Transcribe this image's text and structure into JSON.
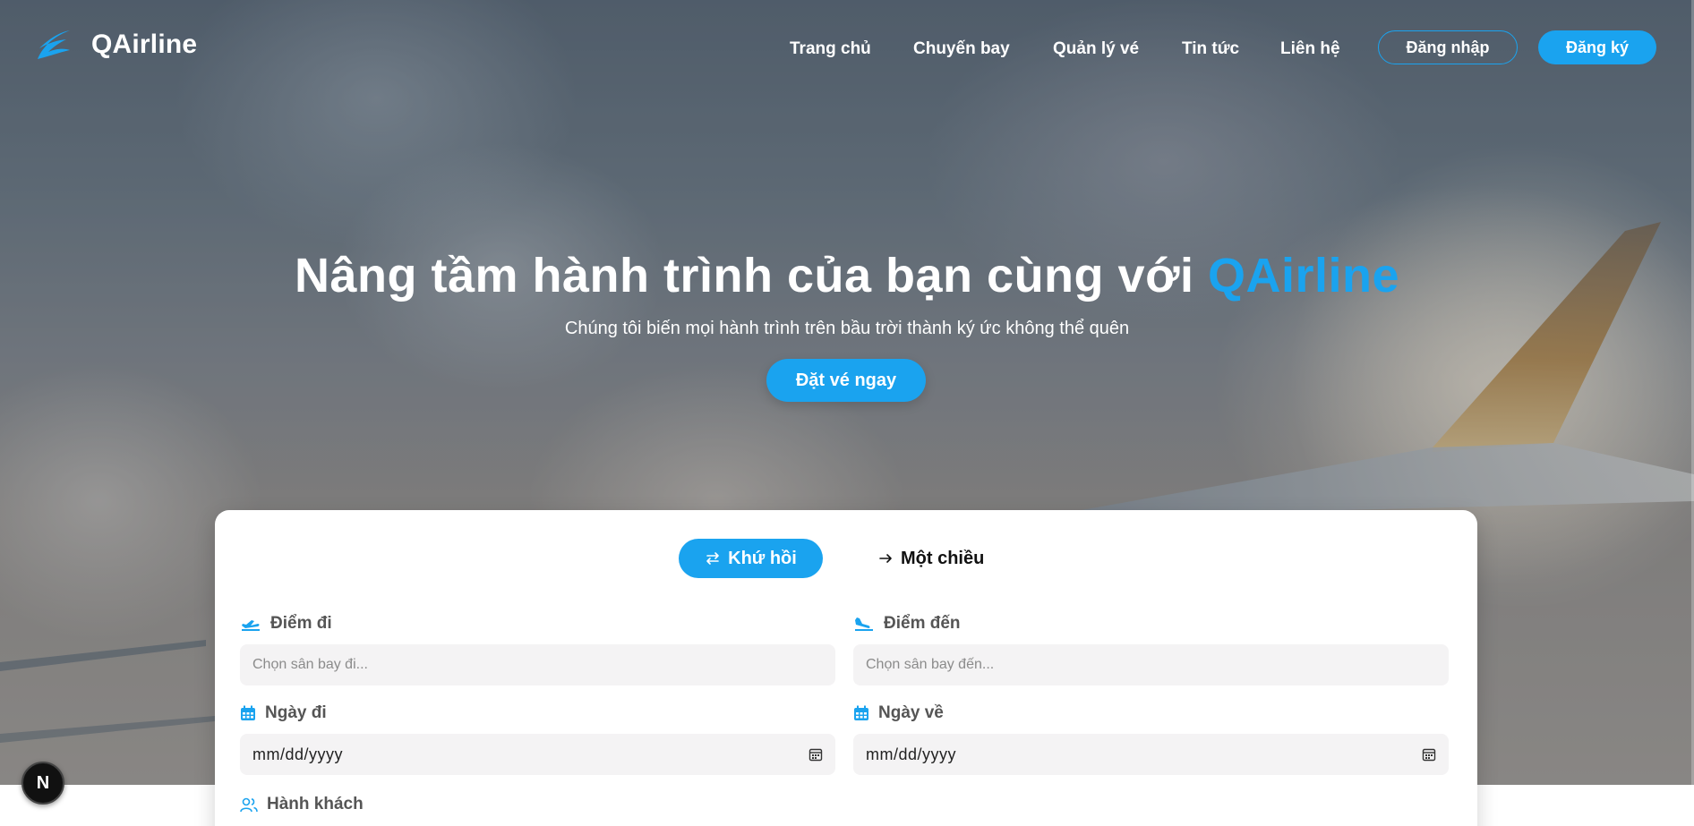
{
  "brand": {
    "name": "QAirline",
    "accent": "#1aa3ef"
  },
  "nav": {
    "items": [
      {
        "label": "Trang chủ"
      },
      {
        "label": "Chuyến bay"
      },
      {
        "label": "Quản lý vé"
      },
      {
        "label": "Tin tức"
      },
      {
        "label": "Liên hệ"
      }
    ],
    "login": "Đăng nhập",
    "register": "Đăng ký"
  },
  "hero": {
    "title_prefix": "Nâng tầm hành trình của bạn cùng với ",
    "title_accent": "QAirline",
    "subtitle": "Chúng tôi biến mọi hành trình trên bầu trời thành ký ức không thể quên",
    "cta": "Đặt vé ngay"
  },
  "booking": {
    "tabs": {
      "round_trip": {
        "label": "Khứ hồi",
        "icon": "swap-arrows-icon",
        "active": true
      },
      "one_way": {
        "label": "Một chiều",
        "icon": "arrow-right-icon",
        "active": false
      }
    },
    "from": {
      "label": "Điểm đi",
      "placeholder": "Chọn sân bay đi..."
    },
    "to": {
      "label": "Điểm đến",
      "placeholder": "Chọn sân bay đến..."
    },
    "depart_date": {
      "label": "Ngày đi",
      "value": "mm/dd/yyyy"
    },
    "return_date": {
      "label": "Ngày về",
      "value": "mm/dd/yyyy"
    },
    "passengers": {
      "label": "Hành khách"
    }
  },
  "dev_badge": {
    "label": "N"
  }
}
